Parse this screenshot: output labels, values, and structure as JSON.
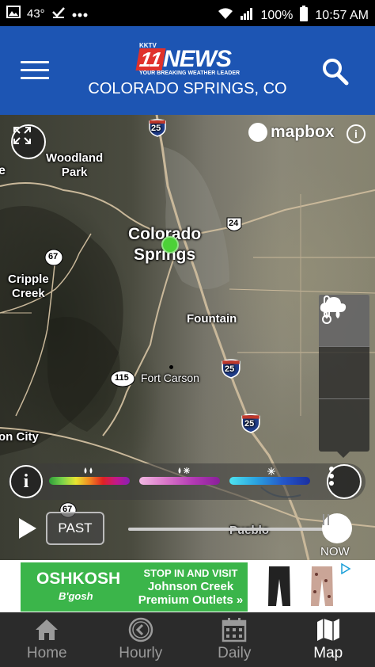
{
  "status_bar": {
    "temperature": "43°",
    "battery": "100%",
    "time": "10:57 AM"
  },
  "header": {
    "logo_station": "KKTV",
    "logo_number": "11",
    "logo_word": "NEWS",
    "logo_tagline": "YOUR BREAKING WEATHER LEADER",
    "location": "COLORADO SPRINGS, CO"
  },
  "map": {
    "attribution": "mapbox",
    "labels": {
      "woodland_park": "Woodland\nPark",
      "colorado_springs": "Colorado\nSprings",
      "cripple_creek": "Cripple\nCreek",
      "fountain": "Fountain",
      "fort_carson": "Fort Carson",
      "canon_city": "on City",
      "pueblo": "Pueblo",
      "left_edge": "e"
    },
    "shields": {
      "i25_north": "25",
      "i25_mid": "25",
      "i25_south": "25",
      "us24": "24",
      "r67": "67",
      "r67_south": "67",
      "r115": "115"
    },
    "current_location_color": "#4cd137"
  },
  "legend": {
    "info_label": "i",
    "scales": [
      "rain",
      "mix",
      "snow"
    ]
  },
  "playback": {
    "past_label": "PAST",
    "now_label": "NOW",
    "progress": 1.0
  },
  "ad": {
    "brand": "OSHKOSH",
    "brand_sub": "B'gosh",
    "line1": "STOP IN AND VISIT",
    "line2": "Johnson Creek",
    "line3": "Premium Outlets »"
  },
  "tabs": [
    {
      "label": "Home",
      "icon": "home-icon",
      "active": false
    },
    {
      "label": "Hourly",
      "icon": "clock-icon",
      "active": false
    },
    {
      "label": "Daily",
      "icon": "calendar-icon",
      "active": false
    },
    {
      "label": "Map",
      "icon": "map-icon",
      "active": true
    }
  ],
  "colors": {
    "header_bg": "#1d55b3",
    "ad_green": "#3bb54a",
    "tabbar_bg": "#2b2b2b"
  }
}
